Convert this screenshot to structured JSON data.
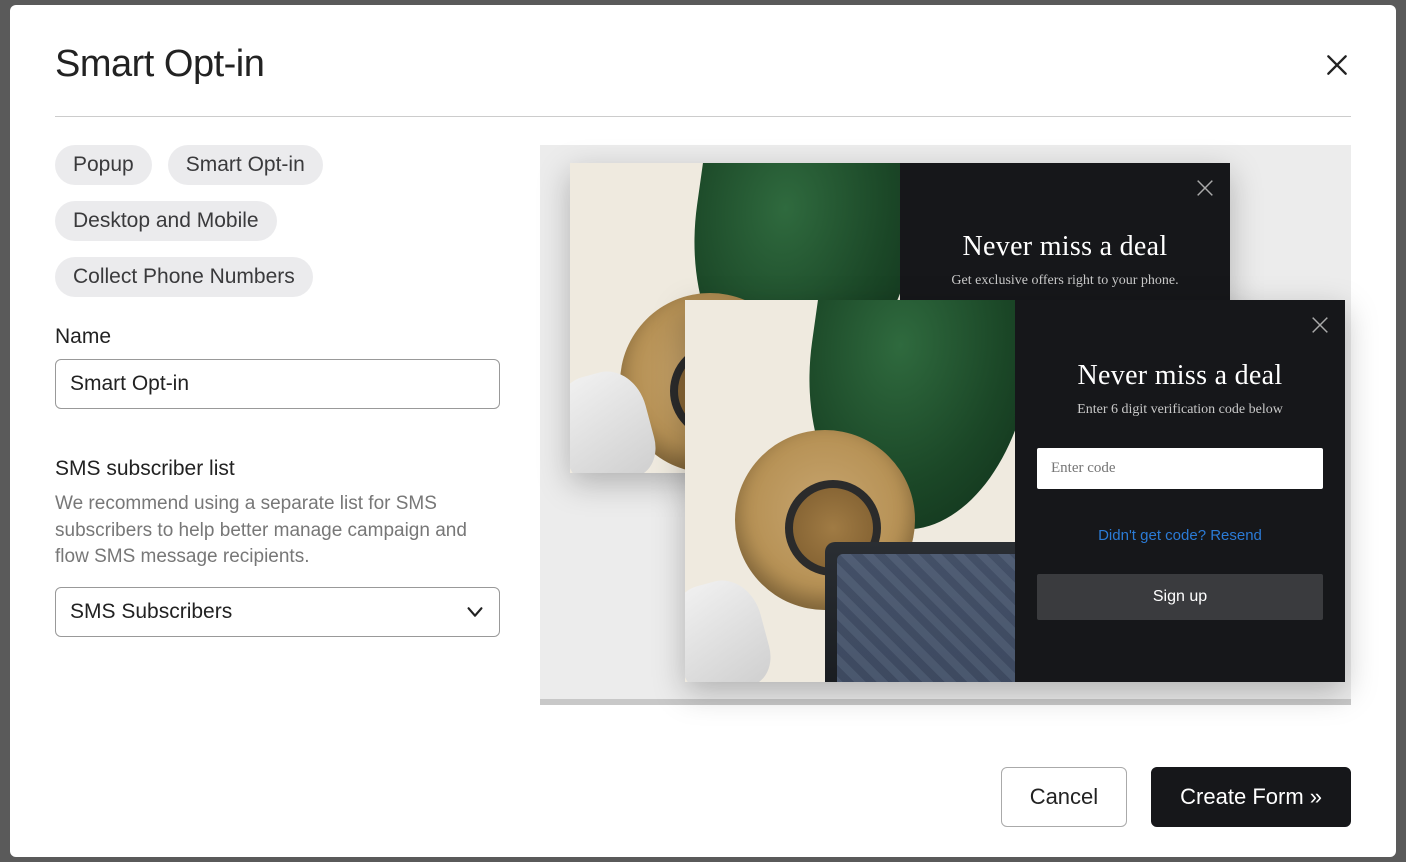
{
  "modal": {
    "title": "Smart Opt-in",
    "tags": [
      "Popup",
      "Smart Opt-in",
      "Desktop and Mobile",
      "Collect Phone Numbers"
    ],
    "name_field": {
      "label": "Name",
      "value": "Smart Opt-in"
    },
    "sms_section": {
      "label": "SMS subscriber list",
      "help": "We recommend using a separate list for SMS subscribers to help better manage campaign and flow SMS message recipients.",
      "selected": "SMS Subscribers"
    },
    "footer": {
      "cancel": "Cancel",
      "create": "Create Form »"
    }
  },
  "preview": {
    "card_a": {
      "heading": "Never miss a deal",
      "sub": "Get exclusive offers right to your phone."
    },
    "card_b": {
      "heading": "Never miss a deal",
      "sub": "Enter 6 digit verification code below",
      "code_placeholder": "Enter code",
      "resend": "Didn't get code? Resend",
      "signup": "Sign up"
    }
  }
}
